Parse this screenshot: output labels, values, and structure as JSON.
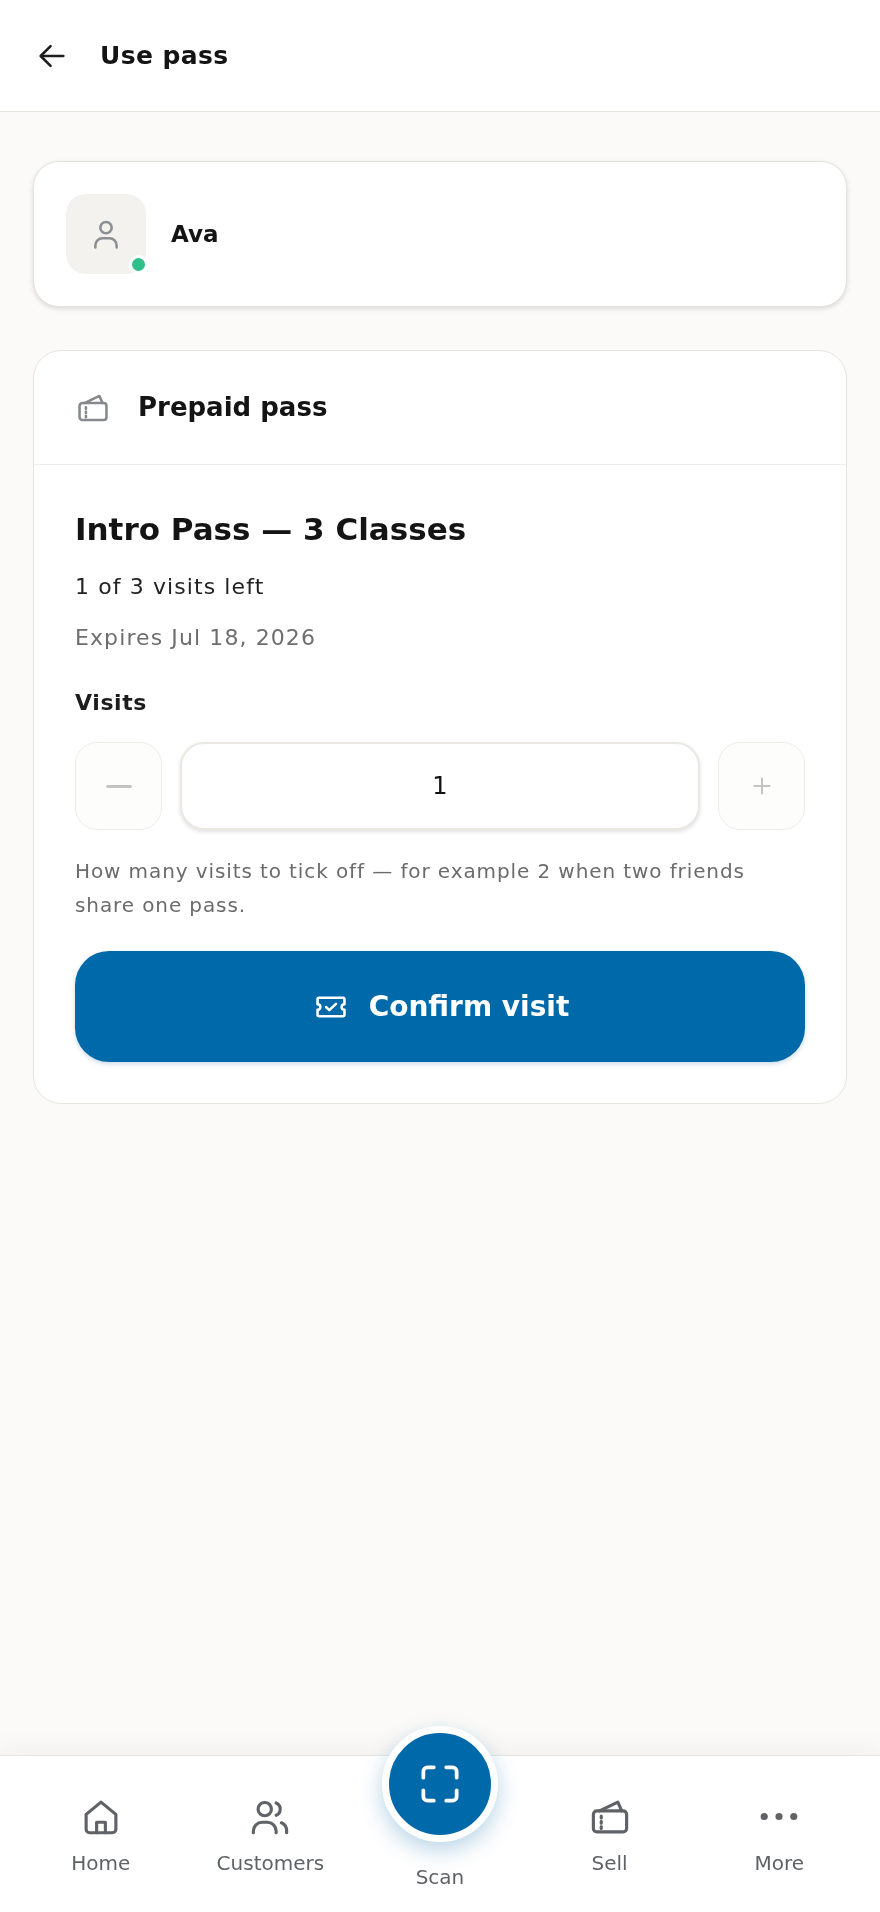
{
  "header": {
    "title": "Use pass"
  },
  "customer": {
    "name": "Ava",
    "online": true
  },
  "pass": {
    "section_title": "Prepaid pass",
    "name": "Intro Pass — 3 Classes",
    "remaining": "1 of 3 visits left",
    "expires": "Expires Jul 18, 2026",
    "visits": {
      "label": "Visits",
      "value": "1",
      "decrement_disabled": true,
      "increment_disabled": true,
      "help_text": "How many visits to tick off — for example 2 when two friends share one pass."
    },
    "confirm_button": "Confirm visit"
  },
  "bottom_nav": [
    {
      "label": "Home",
      "kind": "tab"
    },
    {
      "label": "Customers",
      "kind": "tab"
    },
    {
      "label": "Scan",
      "kind": "fab"
    },
    {
      "label": "Sell",
      "kind": "tab"
    },
    {
      "label": "More",
      "kind": "tab"
    }
  ]
}
